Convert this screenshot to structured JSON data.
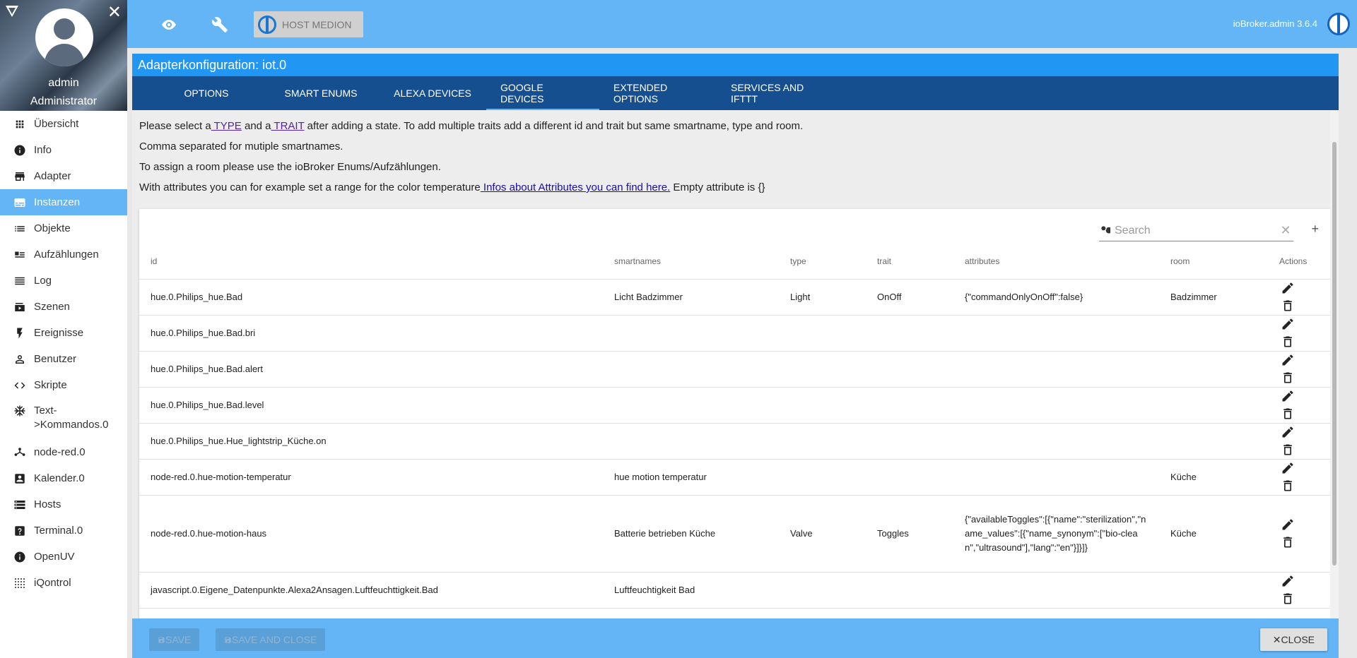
{
  "sidebar": {
    "user": {
      "name": "admin",
      "role": "Administrator"
    },
    "items": [
      {
        "label": "Übersicht",
        "icon": "apps-grid-icon"
      },
      {
        "label": "Info",
        "icon": "info-icon"
      },
      {
        "label": "Adapter",
        "icon": "store-icon"
      },
      {
        "label": "Instanzen",
        "icon": "subtitles-icon",
        "active": true
      },
      {
        "label": "Objekte",
        "icon": "list-icon"
      },
      {
        "label": "Aufzählungen",
        "icon": "enum-icon"
      },
      {
        "label": "Log",
        "icon": "log-lines-icon"
      },
      {
        "label": "Szenen",
        "icon": "scenes-icon"
      },
      {
        "label": "Ereignisse",
        "icon": "flash-icon"
      },
      {
        "label": "Benutzer",
        "icon": "person-icon"
      },
      {
        "label": "Skripte",
        "icon": "code-icon"
      },
      {
        "label": "Text->Kommandos.0",
        "icon": "snowflake-icon"
      },
      {
        "label": "node-red.0",
        "icon": "node-red-icon"
      },
      {
        "label": "Kalender.0",
        "icon": "contact-calendar-icon"
      },
      {
        "label": "Hosts",
        "icon": "storage-icon"
      },
      {
        "label": "Terminal.0",
        "icon": "help-box-icon"
      },
      {
        "label": "OpenUV",
        "icon": "info-icon"
      },
      {
        "label": "iQontrol",
        "icon": "dots-grid-icon"
      }
    ]
  },
  "topbar": {
    "host_label": "HOST MEDION",
    "version": "ioBroker.admin 3.6.4"
  },
  "dialog": {
    "title": "Adapterkonfiguration: iot.0",
    "tabs": [
      {
        "label": "OPTIONS"
      },
      {
        "label": "SMART ENUMS"
      },
      {
        "label": "ALEXA DEVICES"
      },
      {
        "label": "GOOGLE DEVICES",
        "active": true
      },
      {
        "label": "EXTENDED OPTIONS"
      },
      {
        "label": "SERVICES AND IFTTT"
      }
    ],
    "info": {
      "line1_pre": "Please select a",
      "line1_type": " TYPE",
      "line1_mid": " and a",
      "line1_trait": " TRAIT",
      "line1_post": " after adding a state. To add multiple traits add a different id and trait but same smartname, type and room.",
      "line2": "Comma separated for mutiple smartnames.",
      "line3": "To assign a room please use the ioBroker Enums/Aufzählungen.",
      "line4_pre": "With attributes you can for example set a range for the color temperature",
      "line4_link": " Infos about Attributes you can find here.",
      "line4_post": " Empty attribute is {}"
    },
    "search": {
      "placeholder": "Search"
    },
    "table": {
      "headers": [
        "id",
        "smartnames",
        "type",
        "trait",
        "attributes",
        "room",
        "Actions"
      ],
      "rows": [
        [
          "hue.0.Philips_hue.Bad",
          "Licht Badzimmer",
          "Light",
          "OnOff",
          "{\"commandOnlyOnOff\":false}",
          "Badzimmer"
        ],
        [
          "hue.0.Philips_hue.Bad.bri",
          "",
          "",
          "",
          "",
          ""
        ],
        [
          "hue.0.Philips_hue.Bad.alert",
          "",
          "",
          "",
          "",
          ""
        ],
        [
          "hue.0.Philips_hue.Bad.level",
          "",
          "",
          "",
          "",
          ""
        ],
        [
          "hue.0.Philips_hue.Hue_lightstrip_Küche.on",
          "",
          "",
          "",
          "",
          ""
        ],
        [
          "node-red.0.hue-motion-temperatur",
          "hue motion temperatur",
          "",
          "",
          "",
          "Küche"
        ],
        [
          "node-red.0.hue-motion-haus",
          "Batterie betrieben Küche",
          "Valve",
          "Toggles",
          "{\"availableToggles\":[{\"name\":\"sterilization\",\"name_values\":[{\"name_synonym\":[\"bio-clean\",\"ultrasound\"],\"lang\":\"en\"}]}]}",
          "Küche"
        ],
        [
          "javascript.0.Eigene_Datenpunkte.Alexa2Ansagen.Luftfeuchttigkeit.Bad",
          "Luftfeuchtigkeit Bad",
          "",
          "",
          "",
          ""
        ]
      ]
    },
    "buttons": {
      "save": "SAVE",
      "save_close": "SAVE AND CLOSE",
      "close": "CLOSE"
    }
  }
}
